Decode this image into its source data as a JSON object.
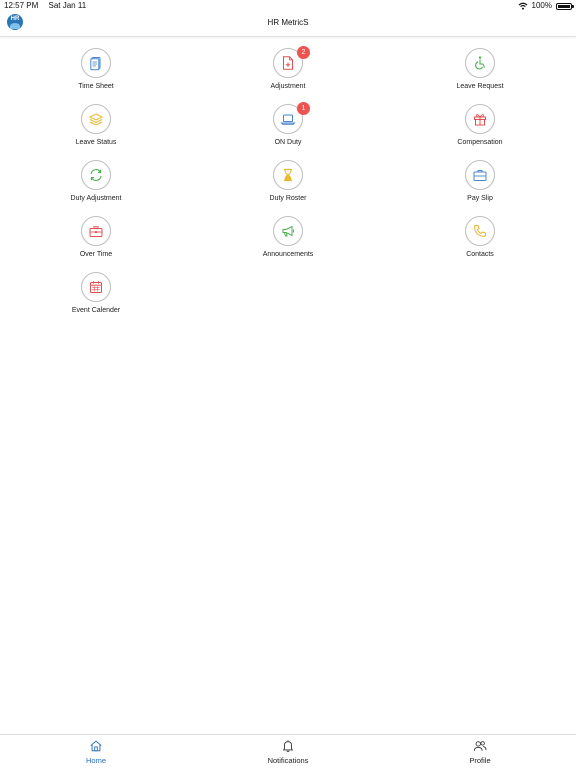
{
  "status_bar": {
    "time": "12:57 PM",
    "date": "Sat Jan 11",
    "battery": "100%",
    "battery_level": 1.0,
    "icons": [
      "wifi-icon",
      "battery-icon"
    ]
  },
  "header": {
    "logo_text": "HR",
    "title": "HR MetricS"
  },
  "colors": {
    "badge": "#ef5350",
    "nav_active": "#2a6fbd",
    "blue": "#4a86c8",
    "red": "#e05050",
    "green": "#4caf50",
    "yellow": "#e9b730",
    "circle_border": "#bdbdbd"
  },
  "tiles": [
    {
      "label": "Time Sheet",
      "icon": "document-icon"
    },
    {
      "label": "Adjustment",
      "icon": "file-plus-icon",
      "badge": "2"
    },
    {
      "label": "Leave Request",
      "icon": "wheelchair-icon"
    },
    {
      "label": "Leave Status",
      "icon": "layers-icon"
    },
    {
      "label": "ON Duty",
      "icon": "laptop-icon",
      "badge": "1"
    },
    {
      "label": "Compensation",
      "icon": "gift-icon"
    },
    {
      "label": "Duty Adjustment",
      "icon": "refresh-icon"
    },
    {
      "label": "Duty Roster",
      "icon": "hourglass-icon"
    },
    {
      "label": "Pay Slip",
      "icon": "briefcase-icon"
    },
    {
      "label": "Over Time",
      "icon": "toolbox-icon"
    },
    {
      "label": "Announcements",
      "icon": "megaphone-icon"
    },
    {
      "label": "Contacts",
      "icon": "phone-icon"
    },
    {
      "label": "Event Calender",
      "icon": "calendar-icon"
    }
  ],
  "bottom_nav": {
    "items": [
      {
        "label": "Home",
        "icon": "home-icon",
        "active": true
      },
      {
        "label": "Notifications",
        "icon": "bell-icon",
        "active": false
      },
      {
        "label": "Profile",
        "icon": "users-icon",
        "active": false
      }
    ]
  }
}
